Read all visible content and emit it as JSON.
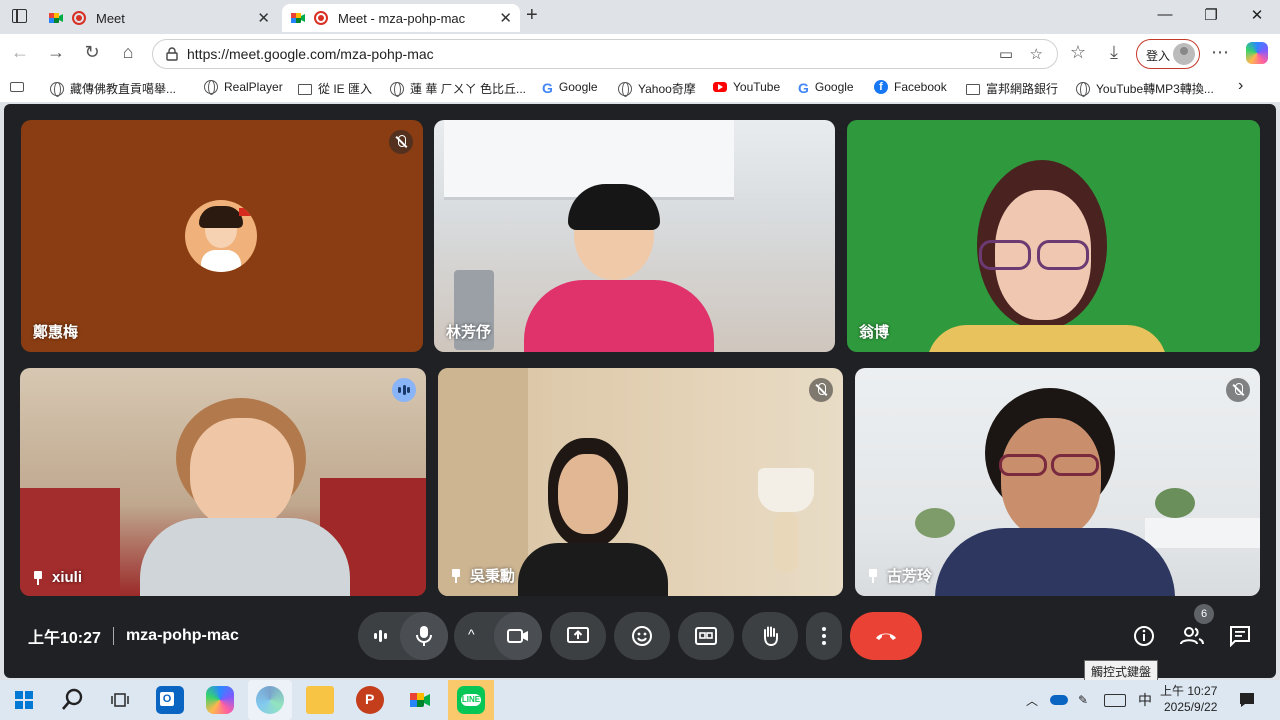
{
  "browser": {
    "tabs": [
      {
        "title": "Meet",
        "active": false
      },
      {
        "title": "Meet - mza-pohp-mac",
        "active": true
      }
    ],
    "url": "https://meet.google.com/mza-pohp-mac",
    "login_label": "登入",
    "favorites": [
      {
        "label": "藏傳佛教直貢噶舉...",
        "icon": "globe-icon"
      },
      {
        "label": "RealPlayer",
        "icon": "globe-icon"
      },
      {
        "label": "從 IE 匯入",
        "icon": "folder-icon"
      },
      {
        "label": "蓮 華 ㄏㄨㄚ 色比丘...",
        "icon": "globe-icon"
      },
      {
        "label": "Google",
        "icon": "google-icon"
      },
      {
        "label": "Yahoo奇摩",
        "icon": "globe-icon"
      },
      {
        "label": "YouTube",
        "icon": "youtube-icon"
      },
      {
        "label": "Google",
        "icon": "google-icon"
      },
      {
        "label": "Facebook",
        "icon": "facebook-icon"
      },
      {
        "label": "富邦網路銀行",
        "icon": "folder-icon"
      },
      {
        "label": "YouTube轉MP3轉換...",
        "icon": "globe-icon"
      }
    ]
  },
  "meet": {
    "participants": [
      {
        "name": "鄭惠梅",
        "state": "muted",
        "pinned": false
      },
      {
        "name": "林芳伃",
        "state": "none",
        "pinned": false
      },
      {
        "name": "翁博",
        "state": "none",
        "pinned": false
      },
      {
        "name": "xiuli",
        "state": "speaking",
        "pinned": true
      },
      {
        "name": "吳秉勳",
        "state": "muted",
        "pinned": true
      },
      {
        "name": "古芳玲",
        "state": "muted",
        "pinned": true
      }
    ],
    "time": "上午10:27",
    "meeting_code": "mza-pohp-mac",
    "participant_count": "6",
    "tooltip": "觸控式鍵盤"
  },
  "taskbar": {
    "ime": "中",
    "clock_time": "上午 10:27",
    "clock_date": "2025/9/22"
  },
  "colors": {
    "meet_bg": "#202124",
    "hangup": "#ea4335",
    "control_bg": "#3c4043",
    "speaking": "#8ab4f8"
  }
}
